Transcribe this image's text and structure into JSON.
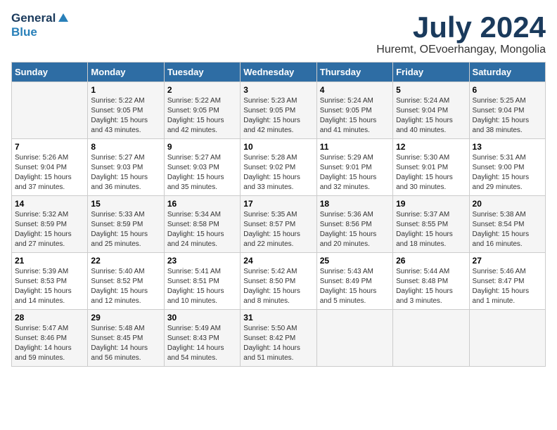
{
  "header": {
    "logo_general": "General",
    "logo_blue": "Blue",
    "month_year": "July 2024",
    "location": "Huremt, OEvoerhangay, Mongolia"
  },
  "weekdays": [
    "Sunday",
    "Monday",
    "Tuesday",
    "Wednesday",
    "Thursday",
    "Friday",
    "Saturday"
  ],
  "weeks": [
    [
      {
        "day": "",
        "info": ""
      },
      {
        "day": "1",
        "info": "Sunrise: 5:22 AM\nSunset: 9:05 PM\nDaylight: 15 hours\nand 43 minutes."
      },
      {
        "day": "2",
        "info": "Sunrise: 5:22 AM\nSunset: 9:05 PM\nDaylight: 15 hours\nand 42 minutes."
      },
      {
        "day": "3",
        "info": "Sunrise: 5:23 AM\nSunset: 9:05 PM\nDaylight: 15 hours\nand 42 minutes."
      },
      {
        "day": "4",
        "info": "Sunrise: 5:24 AM\nSunset: 9:05 PM\nDaylight: 15 hours\nand 41 minutes."
      },
      {
        "day": "5",
        "info": "Sunrise: 5:24 AM\nSunset: 9:04 PM\nDaylight: 15 hours\nand 40 minutes."
      },
      {
        "day": "6",
        "info": "Sunrise: 5:25 AM\nSunset: 9:04 PM\nDaylight: 15 hours\nand 38 minutes."
      }
    ],
    [
      {
        "day": "7",
        "info": "Sunrise: 5:26 AM\nSunset: 9:04 PM\nDaylight: 15 hours\nand 37 minutes."
      },
      {
        "day": "8",
        "info": "Sunrise: 5:27 AM\nSunset: 9:03 PM\nDaylight: 15 hours\nand 36 minutes."
      },
      {
        "day": "9",
        "info": "Sunrise: 5:27 AM\nSunset: 9:03 PM\nDaylight: 15 hours\nand 35 minutes."
      },
      {
        "day": "10",
        "info": "Sunrise: 5:28 AM\nSunset: 9:02 PM\nDaylight: 15 hours\nand 33 minutes."
      },
      {
        "day": "11",
        "info": "Sunrise: 5:29 AM\nSunset: 9:01 PM\nDaylight: 15 hours\nand 32 minutes."
      },
      {
        "day": "12",
        "info": "Sunrise: 5:30 AM\nSunset: 9:01 PM\nDaylight: 15 hours\nand 30 minutes."
      },
      {
        "day": "13",
        "info": "Sunrise: 5:31 AM\nSunset: 9:00 PM\nDaylight: 15 hours\nand 29 minutes."
      }
    ],
    [
      {
        "day": "14",
        "info": "Sunrise: 5:32 AM\nSunset: 8:59 PM\nDaylight: 15 hours\nand 27 minutes."
      },
      {
        "day": "15",
        "info": "Sunrise: 5:33 AM\nSunset: 8:59 PM\nDaylight: 15 hours\nand 25 minutes."
      },
      {
        "day": "16",
        "info": "Sunrise: 5:34 AM\nSunset: 8:58 PM\nDaylight: 15 hours\nand 24 minutes."
      },
      {
        "day": "17",
        "info": "Sunrise: 5:35 AM\nSunset: 8:57 PM\nDaylight: 15 hours\nand 22 minutes."
      },
      {
        "day": "18",
        "info": "Sunrise: 5:36 AM\nSunset: 8:56 PM\nDaylight: 15 hours\nand 20 minutes."
      },
      {
        "day": "19",
        "info": "Sunrise: 5:37 AM\nSunset: 8:55 PM\nDaylight: 15 hours\nand 18 minutes."
      },
      {
        "day": "20",
        "info": "Sunrise: 5:38 AM\nSunset: 8:54 PM\nDaylight: 15 hours\nand 16 minutes."
      }
    ],
    [
      {
        "day": "21",
        "info": "Sunrise: 5:39 AM\nSunset: 8:53 PM\nDaylight: 15 hours\nand 14 minutes."
      },
      {
        "day": "22",
        "info": "Sunrise: 5:40 AM\nSunset: 8:52 PM\nDaylight: 15 hours\nand 12 minutes."
      },
      {
        "day": "23",
        "info": "Sunrise: 5:41 AM\nSunset: 8:51 PM\nDaylight: 15 hours\nand 10 minutes."
      },
      {
        "day": "24",
        "info": "Sunrise: 5:42 AM\nSunset: 8:50 PM\nDaylight: 15 hours\nand 8 minutes."
      },
      {
        "day": "25",
        "info": "Sunrise: 5:43 AM\nSunset: 8:49 PM\nDaylight: 15 hours\nand 5 minutes."
      },
      {
        "day": "26",
        "info": "Sunrise: 5:44 AM\nSunset: 8:48 PM\nDaylight: 15 hours\nand 3 minutes."
      },
      {
        "day": "27",
        "info": "Sunrise: 5:46 AM\nSunset: 8:47 PM\nDaylight: 15 hours\nand 1 minute."
      }
    ],
    [
      {
        "day": "28",
        "info": "Sunrise: 5:47 AM\nSunset: 8:46 PM\nDaylight: 14 hours\nand 59 minutes."
      },
      {
        "day": "29",
        "info": "Sunrise: 5:48 AM\nSunset: 8:45 PM\nDaylight: 14 hours\nand 56 minutes."
      },
      {
        "day": "30",
        "info": "Sunrise: 5:49 AM\nSunset: 8:43 PM\nDaylight: 14 hours\nand 54 minutes."
      },
      {
        "day": "31",
        "info": "Sunrise: 5:50 AM\nSunset: 8:42 PM\nDaylight: 14 hours\nand 51 minutes."
      },
      {
        "day": "",
        "info": ""
      },
      {
        "day": "",
        "info": ""
      },
      {
        "day": "",
        "info": ""
      }
    ]
  ]
}
